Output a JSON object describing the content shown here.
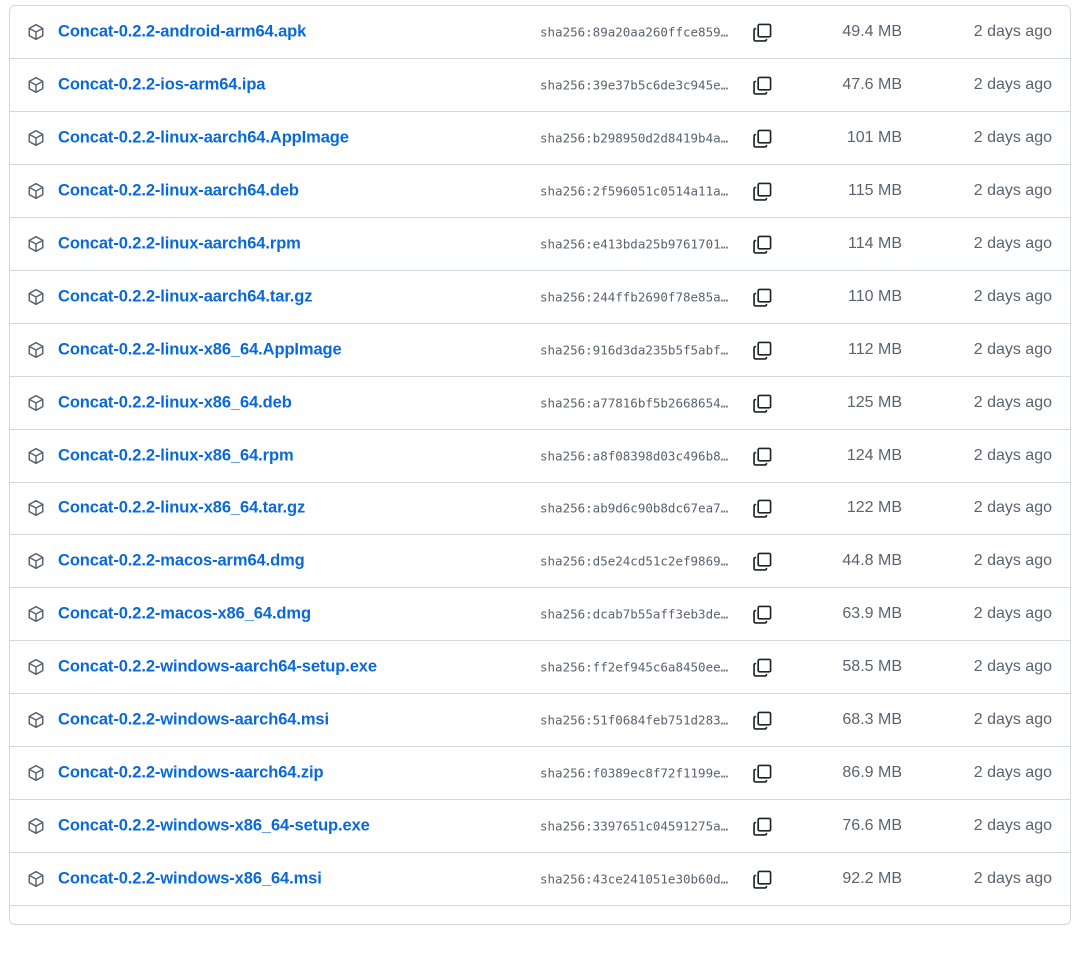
{
  "assets": [
    {
      "name": "Concat-0.2.2-android-arm64.apk",
      "sha": "sha256:89a20aa260ffce859…",
      "size": "49.4 MB",
      "date": "2 days ago"
    },
    {
      "name": "Concat-0.2.2-ios-arm64.ipa",
      "sha": "sha256:39e37b5c6de3c945e…",
      "size": "47.6 MB",
      "date": "2 days ago"
    },
    {
      "name": "Concat-0.2.2-linux-aarch64.AppImage",
      "sha": "sha256:b298950d2d8419b4a…",
      "size": "101 MB",
      "date": "2 days ago"
    },
    {
      "name": "Concat-0.2.2-linux-aarch64.deb",
      "sha": "sha256:2f596051c0514a11a…",
      "size": "115 MB",
      "date": "2 days ago"
    },
    {
      "name": "Concat-0.2.2-linux-aarch64.rpm",
      "sha": "sha256:e413bda25b9761701…",
      "size": "114 MB",
      "date": "2 days ago"
    },
    {
      "name": "Concat-0.2.2-linux-aarch64.tar.gz",
      "sha": "sha256:244ffb2690f78e85a…",
      "size": "110 MB",
      "date": "2 days ago"
    },
    {
      "name": "Concat-0.2.2-linux-x86_64.AppImage",
      "sha": "sha256:916d3da235b5f5abf…",
      "size": "112 MB",
      "date": "2 days ago"
    },
    {
      "name": "Concat-0.2.2-linux-x86_64.deb",
      "sha": "sha256:a77816bf5b2668654…",
      "size": "125 MB",
      "date": "2 days ago"
    },
    {
      "name": "Concat-0.2.2-linux-x86_64.rpm",
      "sha": "sha256:a8f08398d03c496b8…",
      "size": "124 MB",
      "date": "2 days ago"
    },
    {
      "name": "Concat-0.2.2-linux-x86_64.tar.gz",
      "sha": "sha256:ab9d6c90b8dc67ea7…",
      "size": "122 MB",
      "date": "2 days ago"
    },
    {
      "name": "Concat-0.2.2-macos-arm64.dmg",
      "sha": "sha256:d5e24cd51c2ef9869…",
      "size": "44.8 MB",
      "date": "2 days ago"
    },
    {
      "name": "Concat-0.2.2-macos-x86_64.dmg",
      "sha": "sha256:dcab7b55aff3eb3de…",
      "size": "63.9 MB",
      "date": "2 days ago"
    },
    {
      "name": "Concat-0.2.2-windows-aarch64-setup.exe",
      "sha": "sha256:ff2ef945c6a8450ee…",
      "size": "58.5 MB",
      "date": "2 days ago"
    },
    {
      "name": "Concat-0.2.2-windows-aarch64.msi",
      "sha": "sha256:51f0684feb751d283…",
      "size": "68.3 MB",
      "date": "2 days ago"
    },
    {
      "name": "Concat-0.2.2-windows-aarch64.zip",
      "sha": "sha256:f0389ec8f72f1199e…",
      "size": "86.9 MB",
      "date": "2 days ago"
    },
    {
      "name": "Concat-0.2.2-windows-x86_64-setup.exe",
      "sha": "sha256:3397651c04591275a…",
      "size": "76.6 MB",
      "date": "2 days ago"
    },
    {
      "name": "Concat-0.2.2-windows-x86_64.msi",
      "sha": "sha256:43ce241051e30b60d…",
      "size": "92.2 MB",
      "date": "2 days ago"
    },
    {
      "name": "",
      "sha": "",
      "size": "",
      "date": ""
    }
  ],
  "icons": {
    "row_icon": "package-icon",
    "hash_action": "copy-icon"
  },
  "colors": {
    "link": "#0969da",
    "muted": "#59636e",
    "border": "#d1d9e0"
  }
}
